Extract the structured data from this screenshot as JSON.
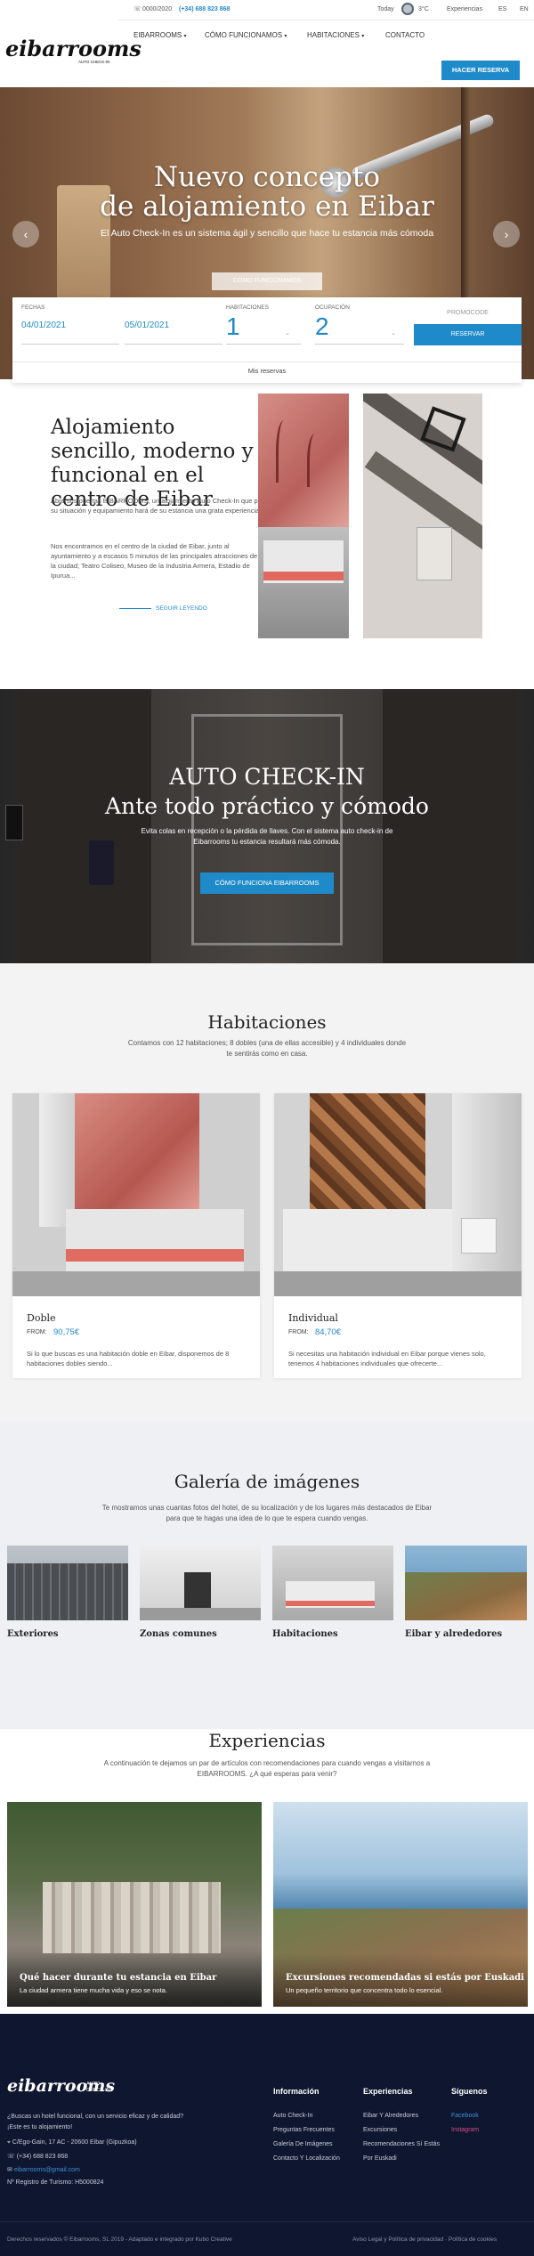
{
  "header": {
    "logo_text": "eibarrooms",
    "logo_tagline": "AUTO CHECK-IN",
    "topbar": {
      "phone_prefix": "0000/2020",
      "phone": "(+34) 688 823 868",
      "today_label": "Today",
      "temperature": "3°C",
      "experiences": "Experiencias",
      "lang_es": "ES",
      "lang_en": "EN"
    },
    "nav": [
      {
        "label": "EIBARROOMS",
        "has_dropdown": true
      },
      {
        "label": "CÓMO FUNCIONAMOS",
        "has_dropdown": true
      },
      {
        "label": "HABITACIONES",
        "has_dropdown": true
      },
      {
        "label": "CONTACTO",
        "has_dropdown": false
      }
    ],
    "reserve_button": "HACER RESERVA"
  },
  "hero": {
    "title_line1": "Nuevo concepto",
    "title_line2": "de alojamiento en Eibar",
    "subtitle": "El Auto Check-In es un sistema ágil y sencillo que hace tu estancia más cómoda",
    "cta": "CÓMO FUNCIONAMOS",
    "prev_icon": "‹",
    "next_icon": "›"
  },
  "booking": {
    "dates_label": "FECHAS",
    "checkin_date": "04/01/2021",
    "checkout_date": "05/01/2021",
    "rooms_label": "HABITACIONES",
    "rooms_value": "1",
    "occupancy_label": "OCUPACIÓN",
    "occupancy_value": "2",
    "promo_label": "PROMOCODE",
    "book_button": "RESERVAR",
    "my_bookings": "Mis reservas"
  },
  "about": {
    "title": "Alojamiento sencillo, moderno y funcional en el centro de Eibar",
    "p1": "Abre sus puertas EIBARROOMS, un alojamiento Auto Check-In que por su situación y equipamiento hará de su estancia una grata experiencia.",
    "p2": "Nos encontramos en el centro de la ciudad de Eibar, junto al ayuntamiento y a escasos 5 minutos de las principales atracciones de la ciudad; Teatro Coliseo, Museo de la Industria Armera, Estadio de Ipurua...",
    "read_more": "SEGUIR LEYENDO"
  },
  "checkin": {
    "title_line1": "AUTO CHECK-IN",
    "title_line2": "Ante todo práctico y cómodo",
    "text": "Evita colas en recepción o la pérdida de llaves. Con el sistema auto check-in de Eibarrooms tu estancia resultará más cómoda.",
    "button": "CÓMO FUNCIONA EIBARROOMS"
  },
  "rooms": {
    "title": "Habitaciones",
    "subtitle": "Contamos con 12 habitaciones; 8 dobles (una de ellas accesible) y 4 individuales donde te sentirás como en casa.",
    "items": [
      {
        "name": "Doble",
        "from": "FROM:",
        "price": "90,75€",
        "desc": "Si lo que buscas es una habitación doble en Eibar, disponemos de 8 habitaciones dobles siendo..."
      },
      {
        "name": "Individual",
        "from": "FROM:",
        "price": "84,70€",
        "desc": "Si necesitas una habitación individual en Eibar porque vienes solo, tenemos 4 habitaciones individuales que ofrecerte..."
      }
    ]
  },
  "gallery": {
    "title": "Galería de imágenes",
    "subtitle": "Te mostramos unas cuantas fotos del hotel, de su localización y de los lugares más destacados de Eibar para que te hagas una idea de lo que te espera cuando vengas.",
    "items": [
      {
        "label": "Exteriores"
      },
      {
        "label": "Zonas comunes"
      },
      {
        "label": "Habitaciones"
      },
      {
        "label": "Eibar y alrededores"
      }
    ]
  },
  "experiences": {
    "title": "Experiencias",
    "subtitle": "A continuación te dejamos un par de artículos con recomendaciones para cuando vengas a visitarnos a EIBARROOMS. ¿A qué esperas para venir?",
    "items": [
      {
        "title": "Qué hacer durante tu estancia en Eibar",
        "desc": "La ciudad armera tiene mucha vida y eso se nota."
      },
      {
        "title": "Excursiones recomendadas si estás por Euskadi",
        "desc": "Un pequeño territorio que concentra todo lo esencial."
      }
    ]
  },
  "footer": {
    "logo_text": "eibarrooms",
    "logo_tagline_1": "AUTO",
    "logo_tagline_2": "CHECK-IN",
    "intro_1": "¿Buscas un hotel funcional, con un servicio eficaz y de calidad?",
    "intro_2": "¡Este es tu alojamiento!",
    "address": "C/Ego-Gain, 17 AC - 20600 Eibar (Gipuzkoa)",
    "phone": "(+34) 688 823 868",
    "email": "eibarrooms@gmail.com",
    "registry": "Nº Registro de Turismo: H5000824",
    "col_info": {
      "title": "Información",
      "links": [
        "Auto Check-In",
        "Preguntas Frecuentes",
        "Galería De Imágenes",
        "Contacto Y Localización"
      ]
    },
    "col_exp": {
      "title": "Experiencias",
      "links": [
        "Eibar Y Alrededores",
        "Excursiones",
        "Recomendaciones Sí Estás",
        "Por Euskadi"
      ]
    },
    "col_follow": {
      "title": "Síguenos",
      "links": [
        "Facebook",
        "Instagram"
      ]
    },
    "rights": "Derechos reservados © Eibarrooms, SL 2019 - Adaptado e integrado por Kubo Creative",
    "legal": "Aviso Legal y Política de privacidad · Política de cookies"
  },
  "colors": {
    "accent": "#1f8ac9",
    "footer_bg": "#0f1730",
    "social_facebook": "#3b8fd9",
    "social_instagram": "#d94a8c"
  }
}
